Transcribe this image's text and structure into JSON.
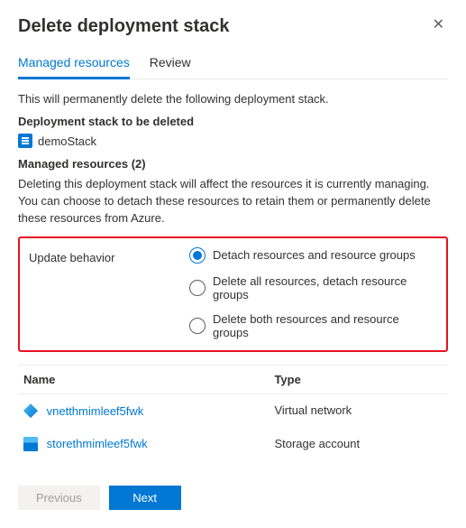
{
  "header": {
    "title": "Delete deployment stack"
  },
  "tabs": {
    "managed": "Managed resources",
    "review": "Review"
  },
  "intro": "This will permanently delete the following deployment stack.",
  "stackSection": {
    "label": "Deployment stack to be deleted",
    "name": "demoStack"
  },
  "managedLabel": "Managed resources (2)",
  "managedDesc": "Deleting this deployment stack will affect the resources it is currently managing. You can choose to detach these resources to retain them or permanently delete these resources from Azure.",
  "behavior": {
    "label": "Update behavior",
    "options": {
      "detach": "Detach resources and resource groups",
      "deleteRes": "Delete all resources, detach resource groups",
      "deleteBoth": "Delete both resources and resource groups"
    }
  },
  "table": {
    "colName": "Name",
    "colType": "Type",
    "rows": [
      {
        "name": "vnetthmimleef5fwk",
        "type": "Virtual network",
        "iconClass": "vnet"
      },
      {
        "name": "storethmimleef5fwk",
        "type": "Storage account",
        "iconClass": "storage"
      }
    ]
  },
  "footer": {
    "previous": "Previous",
    "next": "Next"
  }
}
